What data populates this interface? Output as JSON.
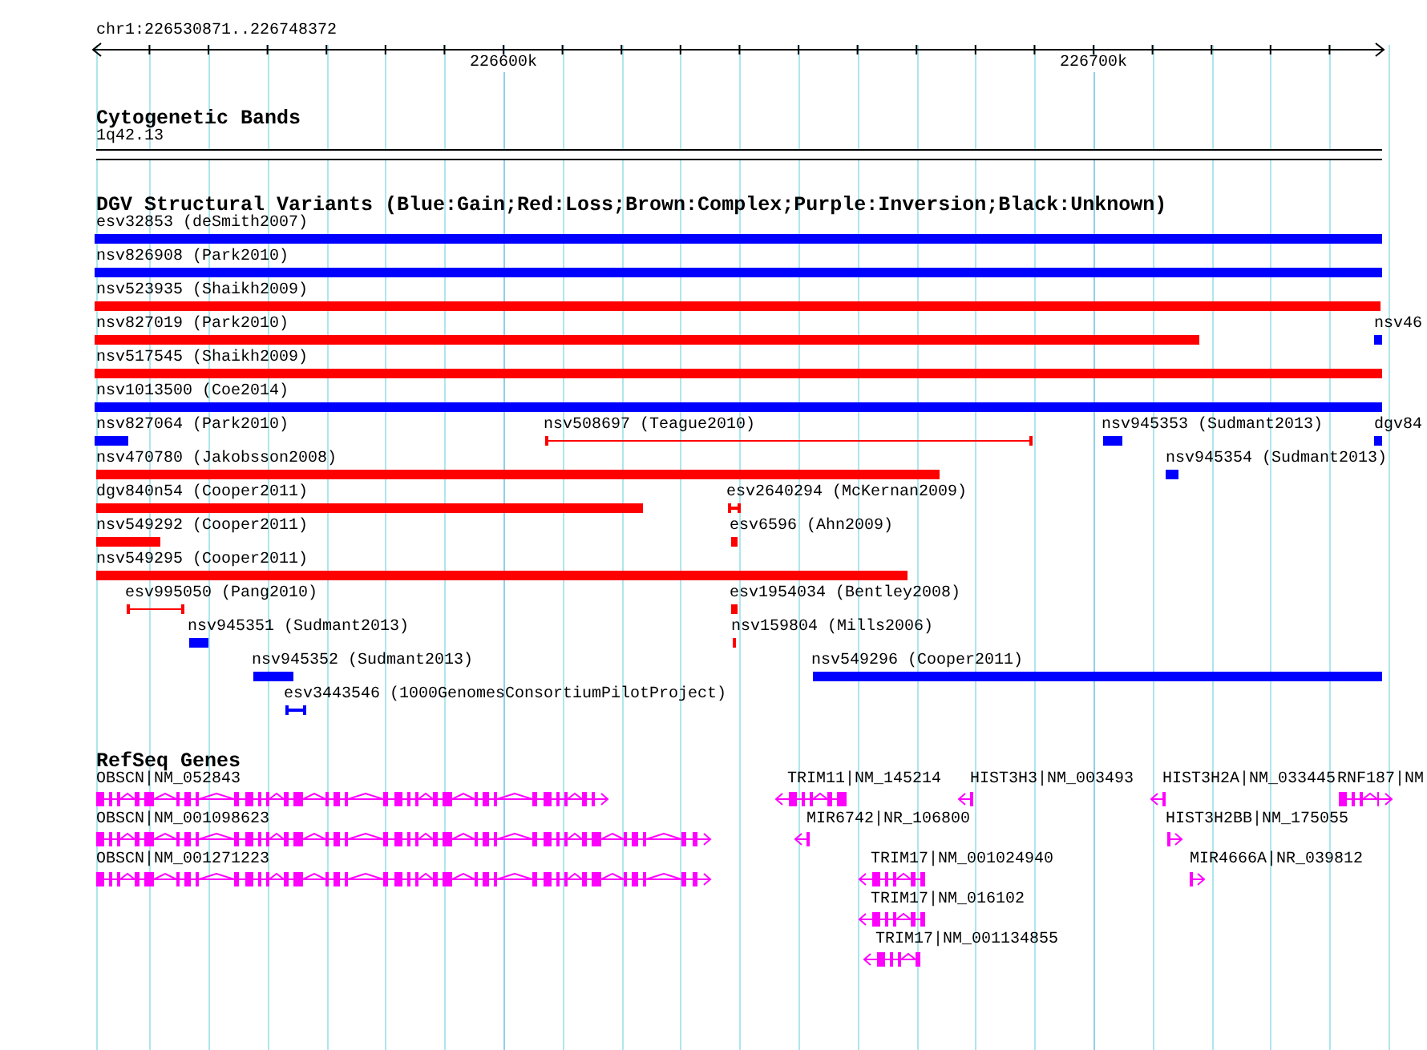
{
  "ruler": {
    "location": "chr1:226530871..226748372",
    "ticks": [
      "226600k",
      "226700k"
    ]
  },
  "tracks": [
    {
      "title": "Cytogenetic Bands",
      "kind": "bands",
      "features": [
        {
          "label": "1q42.13"
        }
      ]
    },
    {
      "title": "DGV Structural Variants (Blue:Gain;Red:Loss;Brown:Complex;Purple:Inversion;Black:Unknown)",
      "kind": "variants",
      "features": [
        {
          "label": "esv32853 (deSmith2007)",
          "color": "#0000ff",
          "kind": "bar"
        },
        {
          "label": "nsv826908 (Park2010)",
          "color": "#0000ff",
          "kind": "bar"
        },
        {
          "label": "nsv523935 (Shaikh2009)",
          "color": "#ff0000",
          "kind": "bar"
        },
        {
          "label": "nsv827019 (Park2010)",
          "color": "#ff0000",
          "kind": "bar"
        },
        {
          "label": "nsv46",
          "color": "#0000ff",
          "kind": "bar"
        },
        {
          "label": "nsv517545 (Shaikh2009)",
          "color": "#ff0000",
          "kind": "bar"
        },
        {
          "label": "nsv1013500 (Coe2014)",
          "color": "#0000ff",
          "kind": "bar"
        },
        {
          "label": "nsv827064 (Park2010)",
          "color": "#0000ff",
          "kind": "bar"
        },
        {
          "label": "nsv508697 (Teague2010)",
          "color": "#ff0000",
          "kind": "span"
        },
        {
          "label": "nsv945353 (Sudmant2013)",
          "color": "#0000ff",
          "kind": "bar"
        },
        {
          "label": "dgv84",
          "color": "#0000ff",
          "kind": "bar"
        },
        {
          "label": "nsv470780 (Jakobsson2008)",
          "color": "#ff0000",
          "kind": "bar"
        },
        {
          "label": "nsv945354 (Sudmant2013)",
          "color": "#0000ff",
          "kind": "bar"
        },
        {
          "label": "dgv840n54 (Cooper2011)",
          "color": "#ff0000",
          "kind": "bar"
        },
        {
          "label": "esv2640294 (McKernan2009)",
          "color": "#ff0000",
          "kind": "span"
        },
        {
          "label": "nsv549292 (Cooper2011)",
          "color": "#ff0000",
          "kind": "bar"
        },
        {
          "label": "esv6596 (Ahn2009)",
          "color": "#ff0000",
          "kind": "bar"
        },
        {
          "label": "nsv549295 (Cooper2011)",
          "color": "#ff0000",
          "kind": "bar"
        },
        {
          "label": "esv995050 (Pang2010)",
          "color": "#ff0000",
          "kind": "span"
        },
        {
          "label": "esv1954034 (Bentley2008)",
          "color": "#ff0000",
          "kind": "bar"
        },
        {
          "label": "nsv945351 (Sudmant2013)",
          "color": "#0000ff",
          "kind": "bar"
        },
        {
          "label": "nsv159804 (Mills2006)",
          "color": "#ff0000",
          "kind": "bar"
        },
        {
          "label": "nsv945352 (Sudmant2013)",
          "color": "#0000ff",
          "kind": "bar"
        },
        {
          "label": "nsv549296 (Cooper2011)",
          "color": "#0000ff",
          "kind": "bar"
        },
        {
          "label": "esv3443546 (1000GenomesConsortiumPilotProject)",
          "color": "#0000ff",
          "kind": "span"
        }
      ]
    },
    {
      "title": "RefSeq Genes",
      "kind": "genes",
      "features": [
        {
          "label": "OBSCN|NM_052843",
          "reverse": false
        },
        {
          "label": "TRIM11|NM_145214",
          "reverse": true
        },
        {
          "label": "HIST3H3|NM_003493",
          "reverse": true
        },
        {
          "label": "HIST3H2A|NM_033445",
          "reverse": true
        },
        {
          "label": "RNF187|NM",
          "reverse": false
        },
        {
          "label": "OBSCN|NM_001098623",
          "reverse": false
        },
        {
          "label": "MIR6742|NR_106800",
          "reverse": true
        },
        {
          "label": "HIST3H2BB|NM_175055",
          "reverse": false
        },
        {
          "label": "OBSCN|NM_001271223",
          "reverse": false
        },
        {
          "label": "TRIM17|NM_001024940",
          "reverse": true
        },
        {
          "label": "MIR4666A|NR_039812",
          "reverse": false
        },
        {
          "label": "TRIM17|NM_016102",
          "reverse": true
        },
        {
          "label": "TRIM17|NM_001134855",
          "reverse": true
        }
      ]
    }
  ]
}
